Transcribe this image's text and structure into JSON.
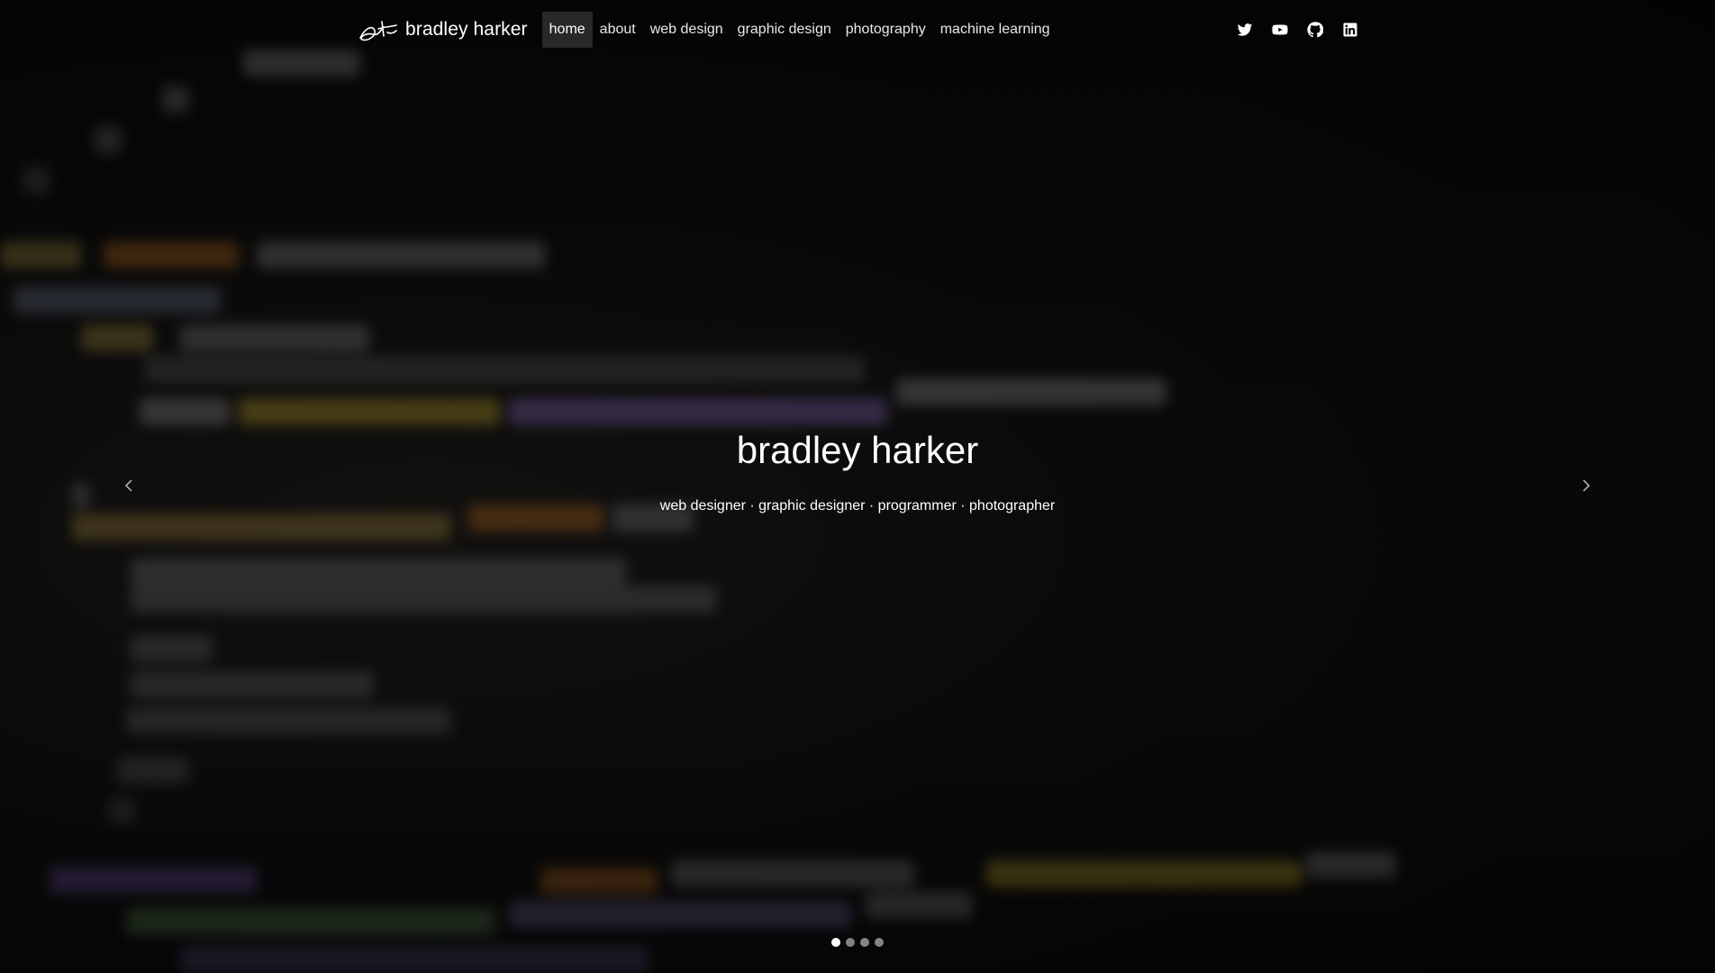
{
  "nav": {
    "brand": "bradley harker",
    "links": [
      {
        "label": "home",
        "active": true
      },
      {
        "label": "about",
        "active": false
      },
      {
        "label": "web design",
        "active": false
      },
      {
        "label": "graphic design",
        "active": false
      },
      {
        "label": "photography",
        "active": false
      },
      {
        "label": "machine learning",
        "active": false
      }
    ],
    "social_icons": [
      "twitter-icon",
      "youtube-icon",
      "github-icon",
      "linkedin-icon"
    ]
  },
  "hero": {
    "title": "bradley harker",
    "subtitle": "web designer · graphic designer · programmer · photographer"
  },
  "carousel": {
    "slide_count": 4,
    "active_slide": 1,
    "prev_icon": "chevron-left-icon",
    "next_icon": "chevron-right-icon"
  },
  "colors": {
    "background": "#0b0b0b",
    "text": "#ffffff",
    "active_nav_bg": "rgba(255,255,255,0.14)"
  }
}
